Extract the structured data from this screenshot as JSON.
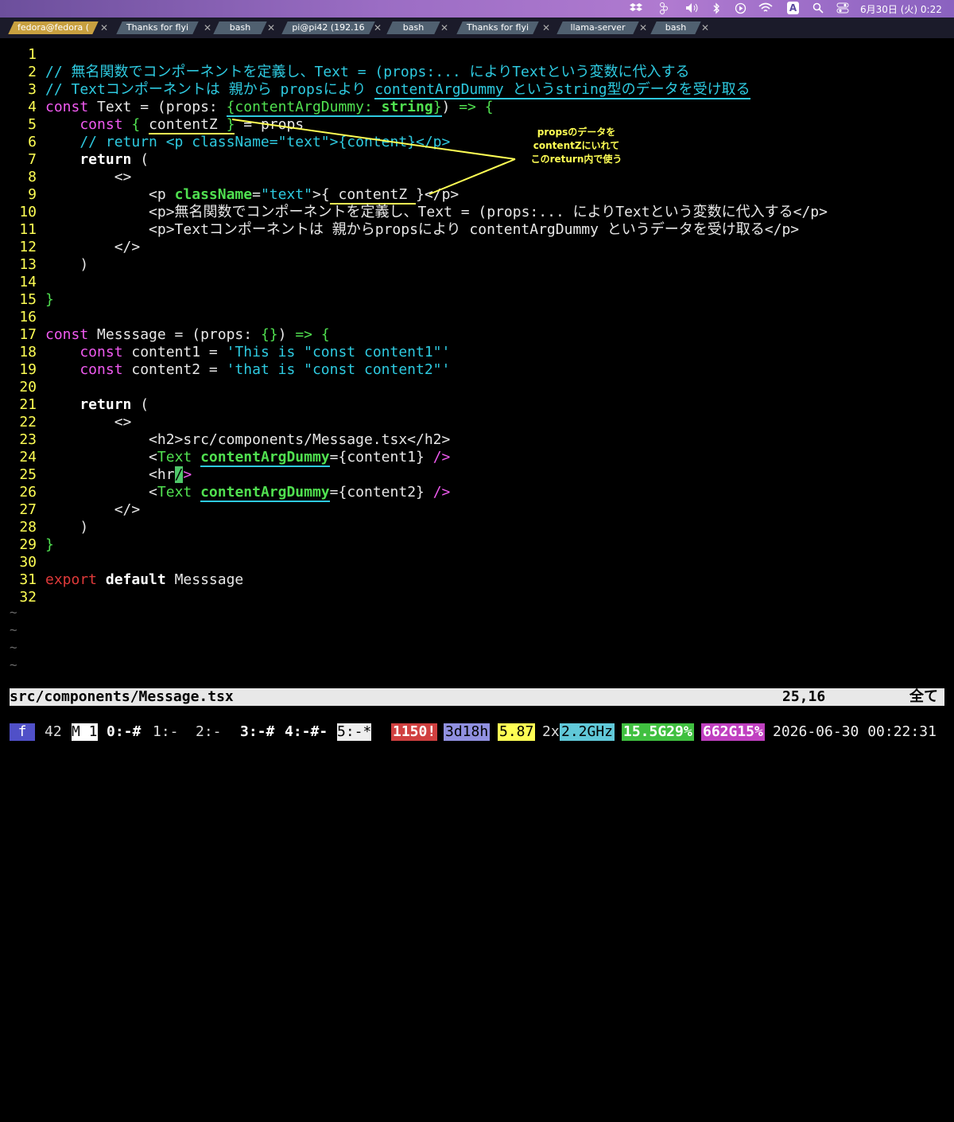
{
  "menubar": {
    "date_time": "6月30日 (火)  0:22",
    "icons": [
      "dropbox-icon",
      "figma-icon",
      "volume-icon",
      "bluetooth-icon",
      "play-icon",
      "wifi-icon",
      "input-source-icon",
      "search-icon",
      "control-center-icon"
    ],
    "input_source": "A"
  },
  "tabs": [
    {
      "label": "fedora@fedora (",
      "active": true
    },
    {
      "label": "Thanks for flyi",
      "active": false
    },
    {
      "label": "bash",
      "active": false
    },
    {
      "label": "pi@pi42 (192.16",
      "active": false
    },
    {
      "label": "bash",
      "active": false
    },
    {
      "label": "Thanks for flyi",
      "active": false
    },
    {
      "label": "llama-server",
      "active": false
    },
    {
      "label": "bash",
      "active": false
    }
  ],
  "tab_close_glyph": "✕",
  "editor": {
    "line_numbers": [
      "1",
      "2",
      "3",
      "4",
      "5",
      "6",
      "7",
      "8",
      "9",
      "10",
      "11",
      "12",
      "13",
      "14",
      "15",
      "16",
      "17",
      "18",
      "19",
      "20",
      "21",
      "22",
      "23",
      "24",
      "25",
      "26",
      "27",
      "28",
      "29",
      "30",
      "31",
      "32"
    ],
    "lines": {
      "l2": "// 無名関数でコンポーネントを定義し、Text = (props:... によりTextという変数に代入する",
      "l3a": "// Textコンポーネントは 親から propsにより ",
      "l3b": "contentArgDummy というstring型のデータを受け取る",
      "l4a": "const",
      "l4b": " Text = (props: ",
      "l4c": "{contentArgDummy: ",
      "l4d": "string",
      "l4e": "}",
      "l4f": ") ",
      "l4g": "=> {",
      "l5a": "    const",
      "l5b": " { ",
      "l5c": "contentZ",
      "l5d": " }",
      "l5e": " = props",
      "l6": "    // return <p className=\"text\">{content}</p>",
      "l7a": "    return",
      "l7b": " (",
      "l8": "        <>",
      "l9a": "            <p ",
      "l9b": "className",
      "l9c": "=",
      "l9d": "\"text\"",
      "l9e": ">{",
      "l9f": " contentZ ",
      "l9g": "}",
      "l9h": "</p>",
      "l10": "            <p>無名関数でコンポーネントを定義し、Text = (props:... によりTextという変数に代入する</p>",
      "l11": "            <p>Textコンポーネントは 親からpropsにより contentArgDummy というデータを受け取る</p>",
      "l12": "        </>",
      "l13": "    )",
      "l15": "}",
      "l17a": "const",
      "l17b": " Messsage = (props: ",
      "l17c": "{}",
      "l17d": ") ",
      "l17e": "=> {",
      "l18a": "    const",
      "l18b": " content1 = ",
      "l18c": "'This is \"const content1\"'",
      "l19a": "    const",
      "l19b": " content2 = ",
      "l19c": "'that is \"const content2\"'",
      "l21a": "    return",
      "l21b": " (",
      "l22": "        <>",
      "l23": "            <h2>src/components/Message.tsx</h2>",
      "l24a": "            <",
      "l24b": "Text",
      "l24c": " ",
      "l24d": "contentArgDummy",
      "l24e": "={content1} ",
      "l24f": "/>",
      "l25a": "            <hr",
      "l25b": "/",
      "l25c": ">",
      "l26a": "            <",
      "l26b": "Text",
      "l26c": " ",
      "l26d": "contentArgDummy",
      "l26e": "={content2} ",
      "l26f": "/>",
      "l27": "        </>",
      "l28": "    )",
      "l29": "}",
      "l31a": "export",
      "l31b": " default",
      "l31c": " Messsage"
    },
    "tilde": "~",
    "annotation": [
      "propsのデータを",
      "contentZにいれて",
      "このreturn内で使う"
    ]
  },
  "statusline": {
    "filename": "src/components/Message.tsx",
    "position": "25,16",
    "percent": "全て"
  },
  "tmux": {
    "session": "f",
    "num": "42",
    "win1": "M 1",
    "windows": [
      "0:-#",
      "1:-",
      "2:-",
      "3:-#",
      "4:-#-",
      "5:-*"
    ],
    "load": "1150!",
    "uptime": "3d18h",
    "loadavg": "5.87",
    "cpu_prefix": "2x",
    "cpu": "2.2GHz",
    "mem": "15.5G29%",
    "disk": "662G15%",
    "datetime": "2026-06-30 00:22:31"
  },
  "colors": {
    "line_number": "#ffff54",
    "comment": "#2ecae0",
    "keyword": "#f05af0",
    "jsx_attr": "#50e050",
    "annotation": "#ffff54"
  }
}
